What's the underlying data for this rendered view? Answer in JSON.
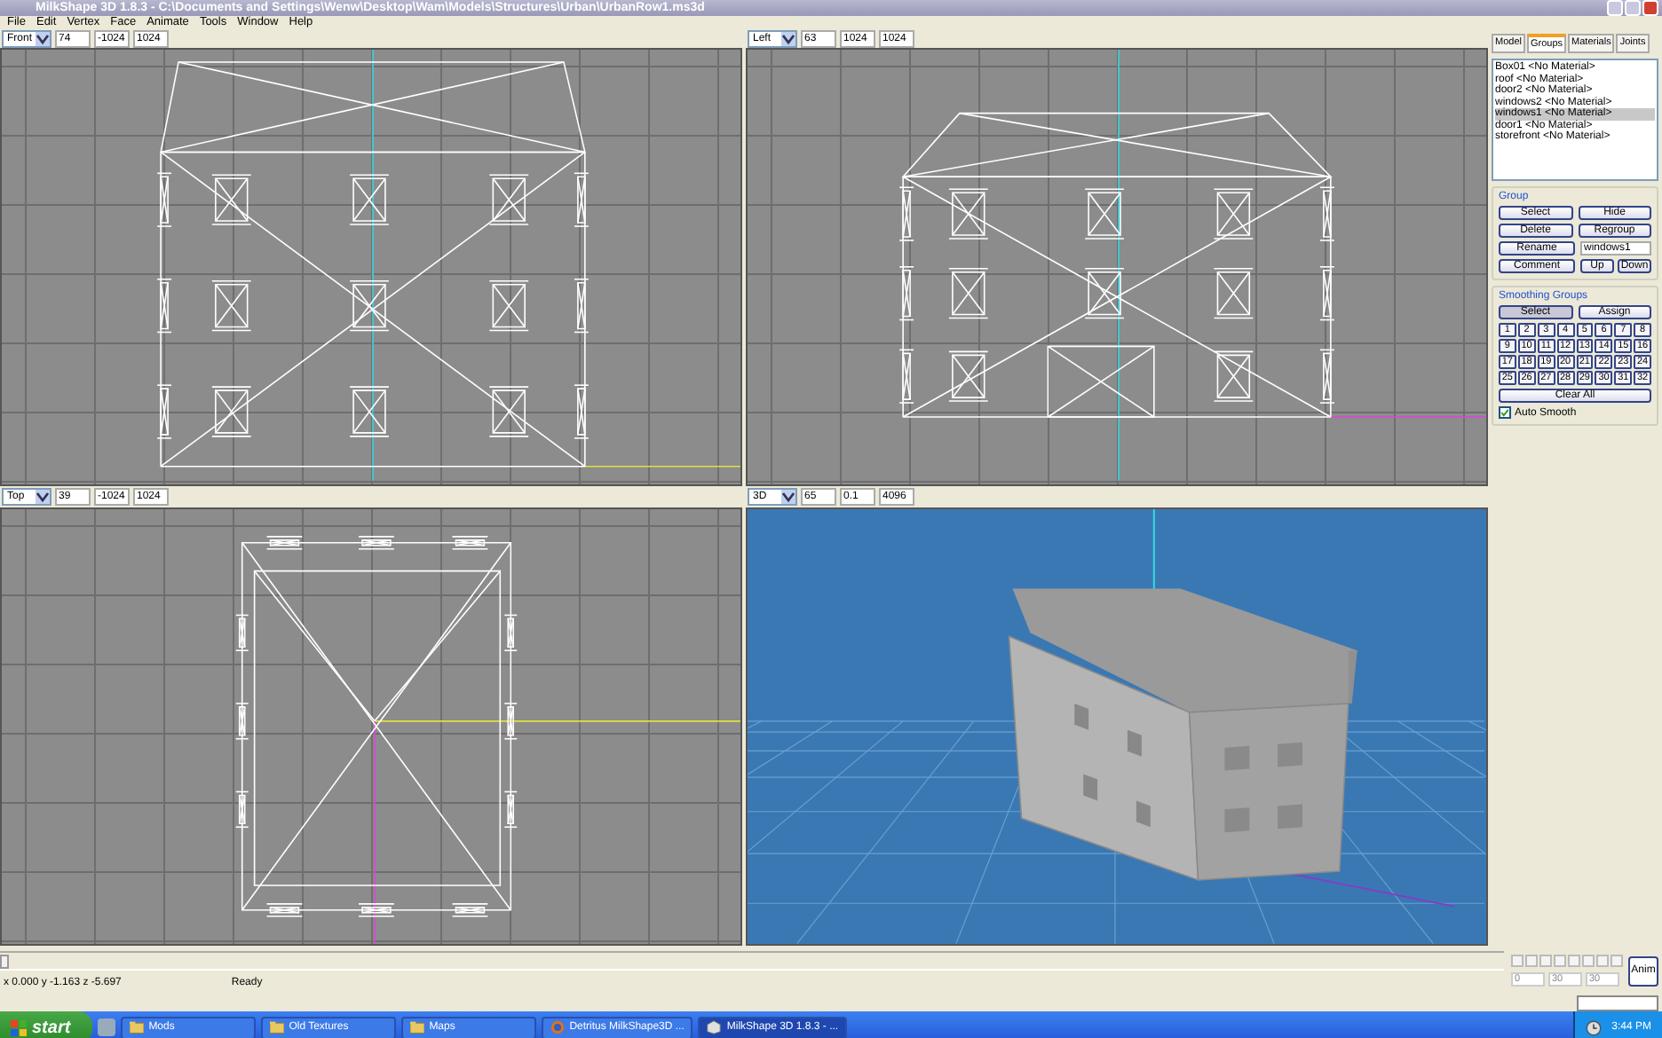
{
  "window": {
    "title": "MilkShape 3D 1.8.3 - C:\\Documents and Settings\\Wenw\\Desktop\\Wam\\Models\\Structures\\Urban\\UrbanRow1.ms3d"
  },
  "menu": [
    "File",
    "Edit",
    "Vertex",
    "Face",
    "Animate",
    "Tools",
    "Window",
    "Help"
  ],
  "viewports": [
    {
      "kind": "front",
      "view": "Front",
      "fields": [
        "74",
        "-1024",
        "1024"
      ]
    },
    {
      "kind": "side",
      "view": "Left",
      "fields": [
        "63",
        "1024",
        "1024"
      ]
    },
    {
      "kind": "top",
      "view": "Top",
      "fields": [
        "39",
        "-1024",
        "1024"
      ]
    },
    {
      "kind": "perspective",
      "view": "3D",
      "fields": [
        "65",
        "0.1",
        "4096"
      ]
    }
  ],
  "panel": {
    "tabs": [
      {
        "label": "Model",
        "selected": false
      },
      {
        "label": "Groups",
        "selected": true
      },
      {
        "label": "Materials",
        "selected": false
      },
      {
        "label": "Joints",
        "selected": false
      }
    ],
    "groups": [
      {
        "label": "Box01 <No Material>",
        "selected": false
      },
      {
        "label": "roof <No Material>",
        "selected": false
      },
      {
        "label": "door2 <No Material>",
        "selected": false
      },
      {
        "label": "windows2 <No Material>",
        "selected": false
      },
      {
        "label": "windows1 <No Material>",
        "selected": true
      },
      {
        "label": "door1 <No Material>",
        "selected": false
      },
      {
        "label": "storefront <No Material>",
        "selected": false
      }
    ],
    "group_box": {
      "title": "Group",
      "buttons": [
        [
          "Select",
          "Hide"
        ],
        [
          "Delete",
          "Regroup"
        ]
      ],
      "rename": "Rename",
      "name_value": "windows1",
      "comment": "Comment",
      "up": "Up",
      "down": "Down"
    },
    "smoothing": {
      "title": "Smoothing Groups",
      "select": "Select",
      "assign": "Assign",
      "numbers": [
        "1",
        "2",
        "3",
        "4",
        "5",
        "6",
        "7",
        "8",
        "9",
        "10",
        "11",
        "12",
        "13",
        "14",
        "15",
        "16",
        "17",
        "18",
        "19",
        "20",
        "21",
        "22",
        "23",
        "24",
        "25",
        "26",
        "27",
        "28",
        "29",
        "30",
        "31",
        "32"
      ],
      "clear": "Clear All",
      "auto_smooth": {
        "label": "Auto Smooth",
        "checked": true
      }
    }
  },
  "timeline": {
    "level": 0,
    "frame_fields": [
      "0",
      "30",
      "30"
    ],
    "anim": "Anim"
  },
  "status_bar": {
    "coords": "x 0.000 y -1.163 z -5.697",
    "message": "Ready"
  },
  "taskbar": {
    "start": "start",
    "items": [
      {
        "label": "Mods",
        "kind": "folder",
        "selected": false
      },
      {
        "label": "Old Textures",
        "kind": "folder",
        "selected": false
      },
      {
        "label": "Maps",
        "kind": "folder",
        "selected": false
      },
      {
        "label": "Detritus MilkShape3D ...",
        "kind": "browser",
        "selected": false
      },
      {
        "label": "MilkShape 3D 1.8.3 - ...",
        "kind": "app",
        "selected": true
      }
    ],
    "clock": "3:44 PM"
  }
}
